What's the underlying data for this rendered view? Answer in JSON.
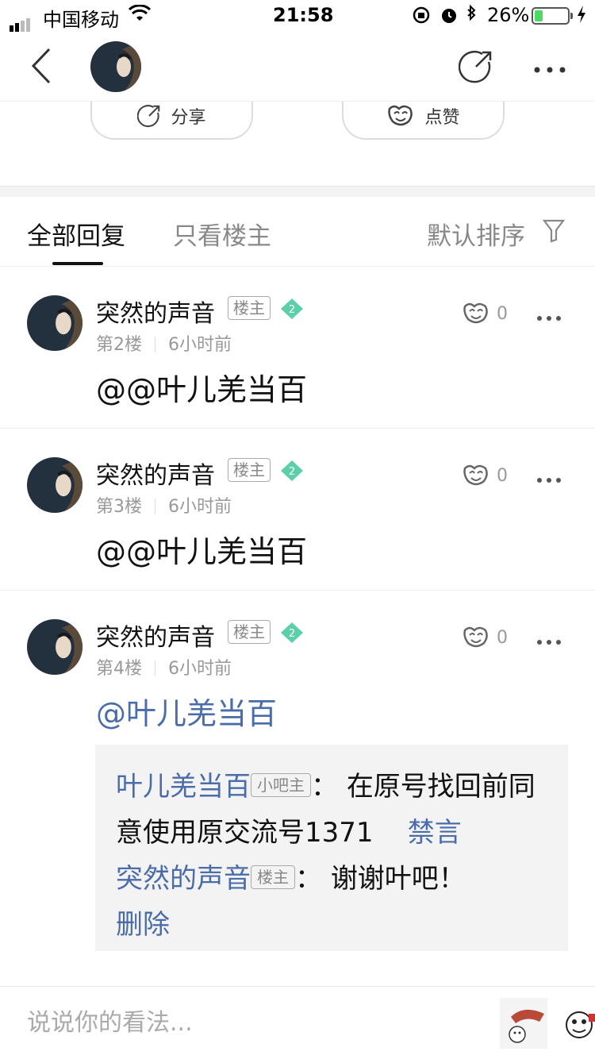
{
  "status_bar": {
    "carrier": "中国移动",
    "time": "21:58",
    "battery_percent": "26%",
    "battery_level": 0.26
  },
  "actions": {
    "share_label": "分享",
    "like_label": "点赞"
  },
  "tabs": {
    "all_label": "全部回复",
    "owner_only_label": "只看楼主",
    "sort_label": "默认排序"
  },
  "posts": [
    {
      "user": "突然的声音",
      "role_badge": "楼主",
      "level": "2",
      "floor": "第2楼",
      "time": "6小时前",
      "likes": "0",
      "content": "@@叶儿羌当百"
    },
    {
      "user": "突然的声音",
      "role_badge": "楼主",
      "level": "2",
      "floor": "第3楼",
      "time": "6小时前",
      "likes": "0",
      "content": "@@叶儿羌当百"
    },
    {
      "user": "突然的声音",
      "role_badge": "楼主",
      "level": "2",
      "floor": "第4楼",
      "time": "6小时前",
      "likes": "0",
      "content": "@叶儿羌当百"
    }
  ],
  "sub_replies": [
    {
      "user": "叶儿羌当百",
      "badge": "小吧主",
      "colon": "：",
      "text": "在原号找回前同意使用原交流号1371",
      "action": "禁言"
    },
    {
      "user": "突然的声音",
      "badge": "楼主",
      "colon": "：",
      "text": "谢谢叶吧！",
      "action": "删除"
    }
  ],
  "input": {
    "placeholder": "说说你的看法..."
  },
  "colors": {
    "link": "#4a6ca8",
    "level_gem": "#5ccfa8",
    "battery_fill": "#4cd964"
  },
  "icons": [
    "back-icon",
    "share-icon",
    "more-icon",
    "like-icon",
    "filter-icon",
    "gem-icon"
  ]
}
